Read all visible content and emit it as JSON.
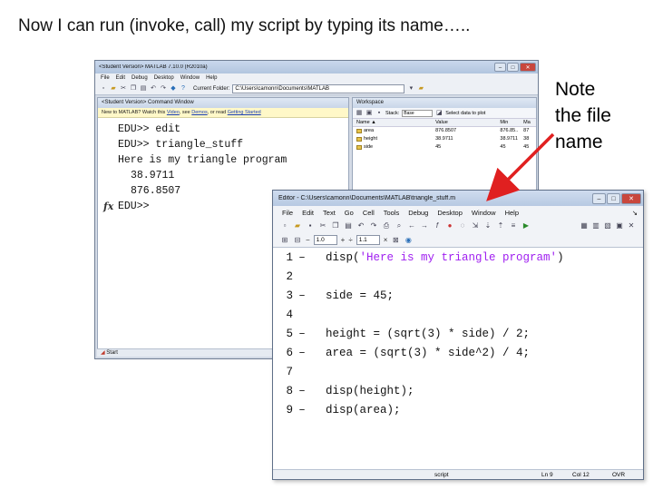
{
  "slide": {
    "title": "Now I can run (invoke, call) my script by typing its name…..",
    "note_lines": [
      "Note",
      "the file",
      "name"
    ]
  },
  "colors": {
    "arrow": "#e02020",
    "string_literal": "#a020f0"
  },
  "matlab": {
    "title": "<Student Version> MATLAB 7.10.0 (R2010a)",
    "window_buttons": [
      "–",
      "□",
      "✕"
    ],
    "menu": [
      "File",
      "Edit",
      "Debug",
      "Desktop",
      "Window",
      "Help"
    ],
    "current_folder_label": "Current Folder:",
    "current_folder_value": "C:\\Users\\camonn\\Documents\\MATLAB",
    "command_window": {
      "title": "<Student Version> Command Window",
      "help_text": "New to MATLAB? Watch this",
      "help_links": [
        "Video",
        "Demos",
        "Getting Started"
      ],
      "help_sep1": ", see",
      "help_sep2": ", or read",
      "lines": [
        "EDU>> edit",
        "EDU>> triangle_stuff",
        "Here is my triangle program"
      ],
      "outputs": [
        "38.9711",
        "876.8507"
      ],
      "prompt": "EDU>>",
      "fx": "fx"
    },
    "workspace": {
      "title": "Workspace",
      "stack_label": "Stack:",
      "stack_value": "Base",
      "plot_label": "Select data to plot",
      "columns": {
        "name": "Name ▲",
        "value": "Value",
        "min": "Min",
        "max": "Ma"
      },
      "rows": [
        {
          "name": "area",
          "value": "876.8507",
          "min": "876.85..",
          "max": "87"
        },
        {
          "name": "height",
          "value": "38.9711",
          "min": "38.9711",
          "max": "38"
        },
        {
          "name": "side",
          "value": "45",
          "min": "45",
          "max": "45"
        }
      ]
    },
    "start_label": "Start"
  },
  "editor": {
    "title": "Editor - C:\\Users\\camonn\\Documents\\MATLAB\\triangle_stuff.m",
    "window_buttons": [
      "–",
      "□",
      "✕"
    ],
    "menu": [
      "File",
      "Edit",
      "Text",
      "Go",
      "Cell",
      "Tools",
      "Debug",
      "Desktop",
      "Window",
      "Help"
    ],
    "zoom_value_1": "1.0",
    "zoom_value_2": "1.1",
    "lines": [
      {
        "n": "1",
        "pre": "disp(",
        "str": "'Here is my triangle program'",
        "post": ")"
      },
      {
        "n": "2",
        "pre": "",
        "str": "",
        "post": ""
      },
      {
        "n": "3",
        "pre": "side = 45;",
        "str": "",
        "post": ""
      },
      {
        "n": "4",
        "pre": "",
        "str": "",
        "post": ""
      },
      {
        "n": "5",
        "pre": "height = (sqrt(3) * side) / 2;",
        "str": "",
        "post": ""
      },
      {
        "n": "6",
        "pre": "area = (sqrt(3) * side^2) / 4;",
        "str": "",
        "post": ""
      },
      {
        "n": "7",
        "pre": "",
        "str": "",
        "post": ""
      },
      {
        "n": "8",
        "pre": "disp(height);",
        "str": "",
        "post": ""
      },
      {
        "n": "9",
        "pre": "disp(area);",
        "str": "",
        "post": ""
      }
    ],
    "status": {
      "type": "script",
      "ln": "Ln 9",
      "col": "Col 12",
      "mode": "OVR"
    }
  }
}
